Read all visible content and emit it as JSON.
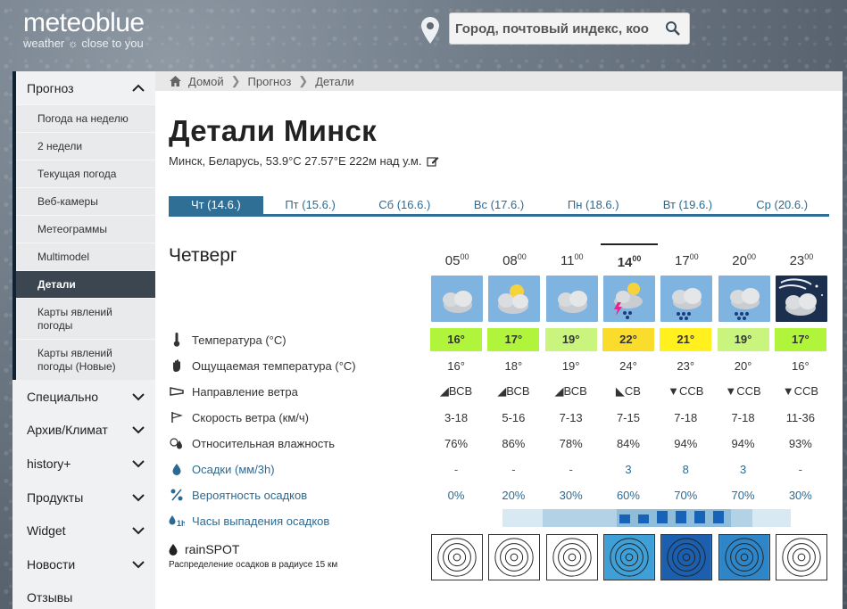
{
  "header": {
    "brand": "meteoblue",
    "tagline": "weather ☼ close to you",
    "search_placeholder": "Город, почтовый индекс, коо"
  },
  "sidebar": {
    "forecast": {
      "label": "Прогноз",
      "items": [
        "Погода на неделю",
        "2 недели",
        "Текущая погода",
        "Веб-камеры",
        "Метеограммы",
        "Multimodel",
        "Детали",
        "Карты явлений погоды",
        "Карты явлений погоды (Новые)"
      ],
      "active": "Детали"
    },
    "sections": [
      "Специально",
      "Архив/Климат",
      "history+",
      "Продукты",
      "Widget",
      "Новости",
      "Отзывы"
    ]
  },
  "breadcrumb": [
    "Домой",
    "Прогноз",
    "Детали"
  ],
  "page": {
    "title": "Детали Минск",
    "location": "Минск, Беларусь, 53.9°C 27.57°E 222м над у.м."
  },
  "tabs": [
    "Чт (14.6.)",
    "Пт (15.6.)",
    "Сб (16.6.)",
    "Вс (17.6.)",
    "Пн (18.6.)",
    "Вт (19.6.)",
    "Ср (20.6.)"
  ],
  "day_name": "Четверг",
  "hours": [
    {
      "h": "05",
      "m": "00"
    },
    {
      "h": "08",
      "m": "00"
    },
    {
      "h": "11",
      "m": "00"
    },
    {
      "h": "14",
      "m": "00"
    },
    {
      "h": "17",
      "m": "00"
    },
    {
      "h": "20",
      "m": "00"
    },
    {
      "h": "23",
      "m": "00"
    }
  ],
  "weather_icons": [
    "cloudy",
    "partly-sunny",
    "cloudy",
    "thunderstorm",
    "showers",
    "showers",
    "night-cloudy"
  ],
  "rows": {
    "temperature": {
      "label": "Температура (°C)",
      "values": [
        "16°",
        "17°",
        "19°",
        "22°",
        "21°",
        "19°",
        "17°"
      ],
      "colors": [
        "#b0f53c",
        "#b0f53c",
        "#c9f57f",
        "#fadc2c",
        "#fff01e",
        "#c9f57f",
        "#b0f53c"
      ]
    },
    "felt": {
      "label": "Ощущаемая температура (°C)",
      "values": [
        "16°",
        "18°",
        "19°",
        "24°",
        "23°",
        "20°",
        "16°"
      ]
    },
    "wind_dir": {
      "label": "Направление ветра",
      "values": [
        "ВСВ",
        "ВСВ",
        "ВСВ",
        "СВ",
        "ССВ",
        "ССВ",
        "ССВ"
      ]
    },
    "wind_speed": {
      "label": "Скорость ветра (км/ч)",
      "values": [
        "3-18",
        "5-16",
        "7-13",
        "7-15",
        "7-18",
        "7-18",
        "11-36"
      ]
    },
    "humidity": {
      "label": "Относительная влажность",
      "values": [
        "76%",
        "86%",
        "78%",
        "84%",
        "94%",
        "94%",
        "93%"
      ]
    },
    "precip": {
      "label": "Осадки (мм/3h)",
      "values": [
        "-",
        "-",
        "-",
        "3",
        "8",
        "3",
        "-"
      ]
    },
    "precip_prob": {
      "label": "Вероятность осадков",
      "values": [
        "0%",
        "20%",
        "30%",
        "60%",
        "70%",
        "70%",
        "30%"
      ]
    },
    "precip_hours": {
      "label": "Часы выпадения осадков"
    }
  },
  "rainspot": {
    "title": "rainSPOT",
    "subtitle": "Распределение осадков в радиусе 15 км",
    "levels": [
      "none",
      "none",
      "none",
      "light",
      "heavy",
      "medium",
      "none"
    ]
  },
  "colors": {
    "accent": "#2f6f96",
    "active_nav": "#3c4650"
  }
}
